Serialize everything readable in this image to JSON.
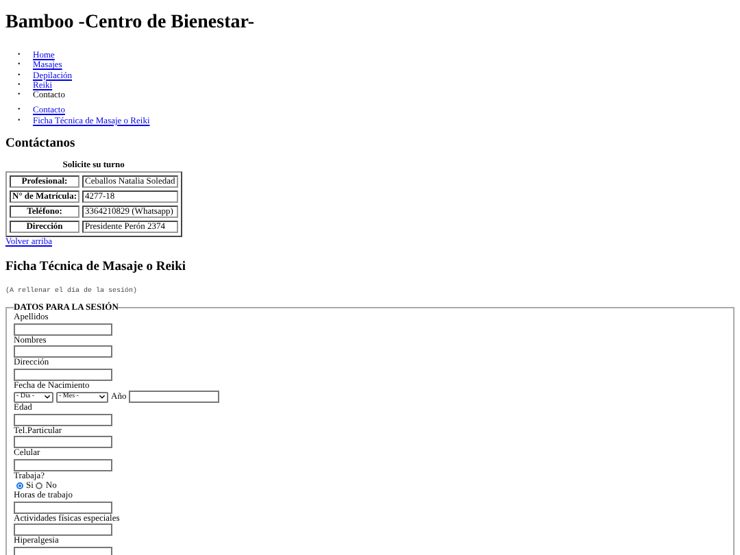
{
  "title": "Bamboo -Centro de Bienestar-",
  "nav": [
    {
      "marker": "•",
      "label": "Home",
      "link": true
    },
    {
      "marker": "•",
      "label": "Masajes",
      "link": true
    },
    {
      "marker": "•",
      "label": "Depilación",
      "link": true
    },
    {
      "marker": "•",
      "label": "Reiki",
      "link": true
    },
    {
      "marker": "•",
      "label": "Contacto",
      "link": false
    }
  ],
  "subnav": [
    {
      "marker": "•",
      "label": "Contacto",
      "link": true
    },
    {
      "marker": "•",
      "label": "Ficha Técnica de Masaje o Reiki",
      "link": true
    }
  ],
  "contact": {
    "heading": "Contáctanos",
    "caption": "Solicite su turno",
    "rows": [
      {
        "label": "Profesional:",
        "value": "Ceballos Natalia Soledad"
      },
      {
        "label": "N° de Matrícula:",
        "value": "4277-18"
      },
      {
        "label": "Teléfono:",
        "value": "3364210829 (Whatsapp)"
      },
      {
        "label": "Dirección",
        "value": "Presidente Perón 2374"
      }
    ],
    "back_link": "Volver arriba"
  },
  "form": {
    "heading": "Ficha Técnica de Masaje o Reiki",
    "note": "(A rellenar el día de la sesión)",
    "legend": "DATOS PARA LA SESIÓN",
    "fields": [
      {
        "kind": "text",
        "label": "Apellidos"
      },
      {
        "kind": "text",
        "label": "Nombres"
      },
      {
        "kind": "text",
        "label": "Dirección"
      },
      {
        "kind": "date",
        "label": "Fecha de Nacimiento",
        "day": "- Día -",
        "month": "- Mes -",
        "year_label": "Año"
      },
      {
        "kind": "text",
        "label": "Edad"
      },
      {
        "kind": "text",
        "label": "Tel.Particular"
      },
      {
        "kind": "text",
        "label": "Celular"
      },
      {
        "kind": "radio",
        "label": "Trabaja?",
        "options": [
          {
            "label": "Si",
            "selected": true
          },
          {
            "label": "No",
            "selected": false
          }
        ]
      },
      {
        "kind": "text",
        "label": "Horas de trabajo"
      },
      {
        "kind": "text",
        "label": "Actividades físicas especiales"
      },
      {
        "kind": "text",
        "label": "Hiperalgesia"
      }
    ]
  }
}
